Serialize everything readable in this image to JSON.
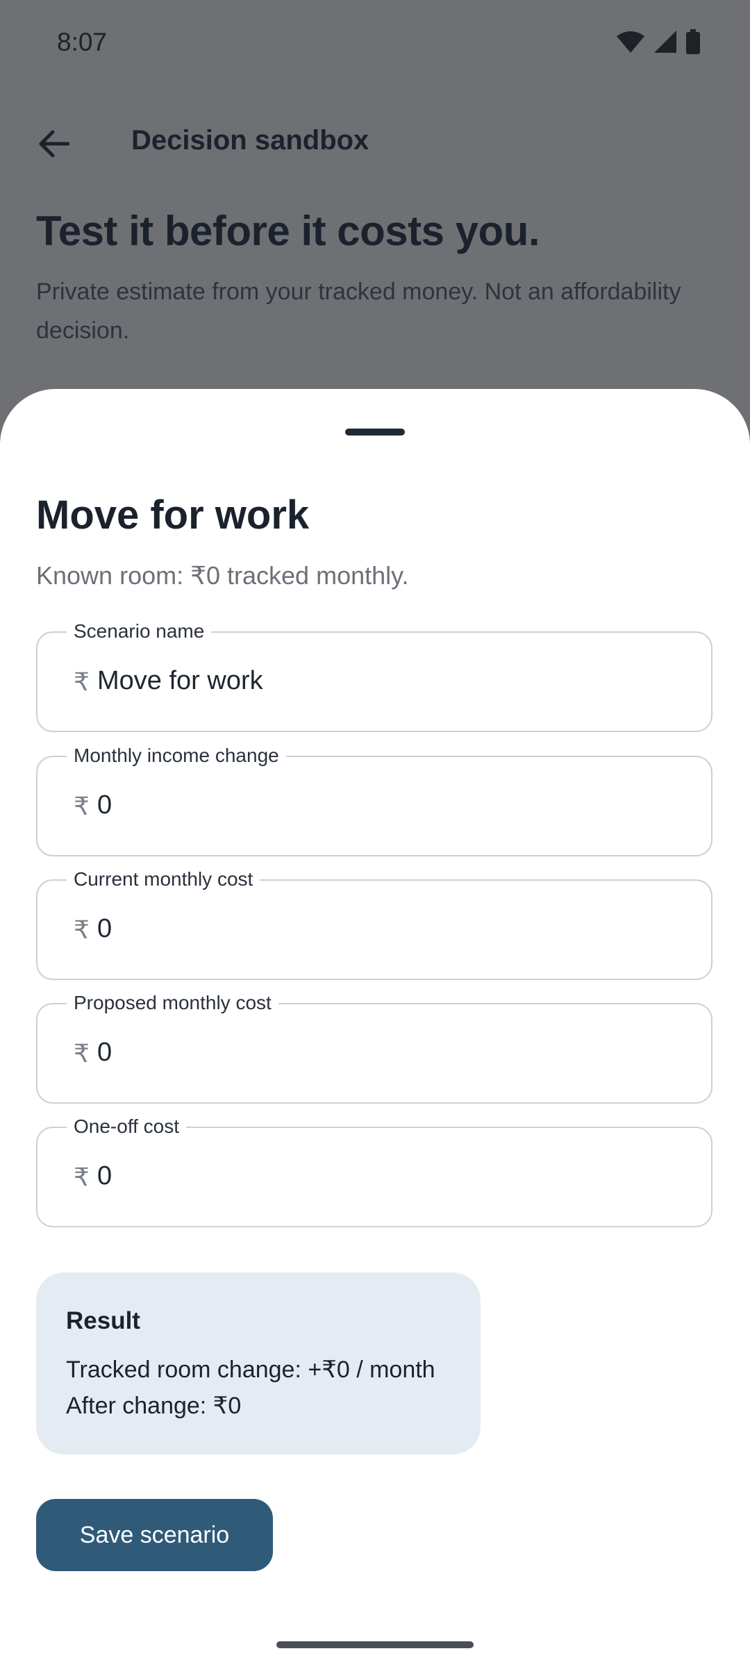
{
  "status_bar": {
    "time": "8:07",
    "icons": [
      "wifi-icon",
      "signal-icon",
      "battery-icon"
    ]
  },
  "app_bar": {
    "back_icon": "arrow-left-icon",
    "title": "Decision sandbox"
  },
  "hero": {
    "title": "Test it before it costs you.",
    "subtitle": "Private estimate from your tracked money. Not an affordability decision."
  },
  "sheet": {
    "title": "Move for work",
    "subtitle": "Known room: ₹0 tracked monthly.",
    "fields": [
      {
        "label": "Scenario name",
        "prefix": "₹",
        "value": "Move for work"
      },
      {
        "label": "Monthly income change",
        "prefix": "₹",
        "value": "0"
      },
      {
        "label": "Current monthly cost",
        "prefix": "₹",
        "value": "0"
      },
      {
        "label": "Proposed monthly cost",
        "prefix": "₹",
        "value": "0"
      },
      {
        "label": "One-off cost",
        "prefix": "₹",
        "value": "0"
      }
    ],
    "result": {
      "title": "Result",
      "line1": "Tracked room change: +₹0 / month",
      "line2": "After change: ₹0"
    },
    "save_label": "Save scenario"
  },
  "colors": {
    "primary": "#2f5b78",
    "scrim": "#6f7073",
    "result_bg": "#e5ebf2"
  }
}
